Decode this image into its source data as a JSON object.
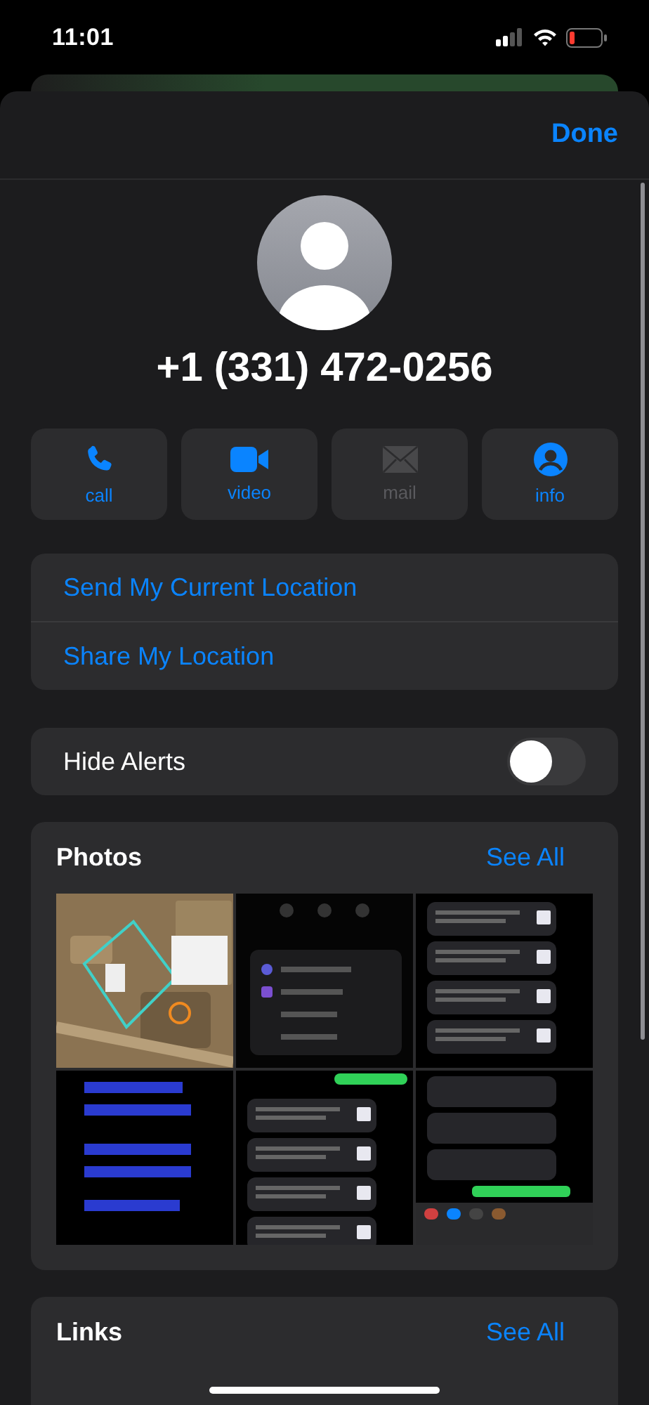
{
  "status_bar": {
    "time": "11:01"
  },
  "nav": {
    "done": "Done"
  },
  "contact": {
    "phone": "+1 (331) 472-0256"
  },
  "actions": [
    {
      "label": "call",
      "kind": "phone",
      "disabled": false
    },
    {
      "label": "video",
      "kind": "video",
      "disabled": false
    },
    {
      "label": "mail",
      "kind": "mail",
      "disabled": true
    },
    {
      "label": "info",
      "kind": "info",
      "disabled": false
    }
  ],
  "location_actions": [
    {
      "label": "Send My Current Location"
    },
    {
      "label": "Share My Location"
    }
  ],
  "hide_alerts": {
    "label": "Hide Alerts",
    "on": false
  },
  "photos": {
    "title": "Photos",
    "see_all": "See All"
  },
  "links": {
    "title": "Links",
    "see_all": "See All"
  }
}
